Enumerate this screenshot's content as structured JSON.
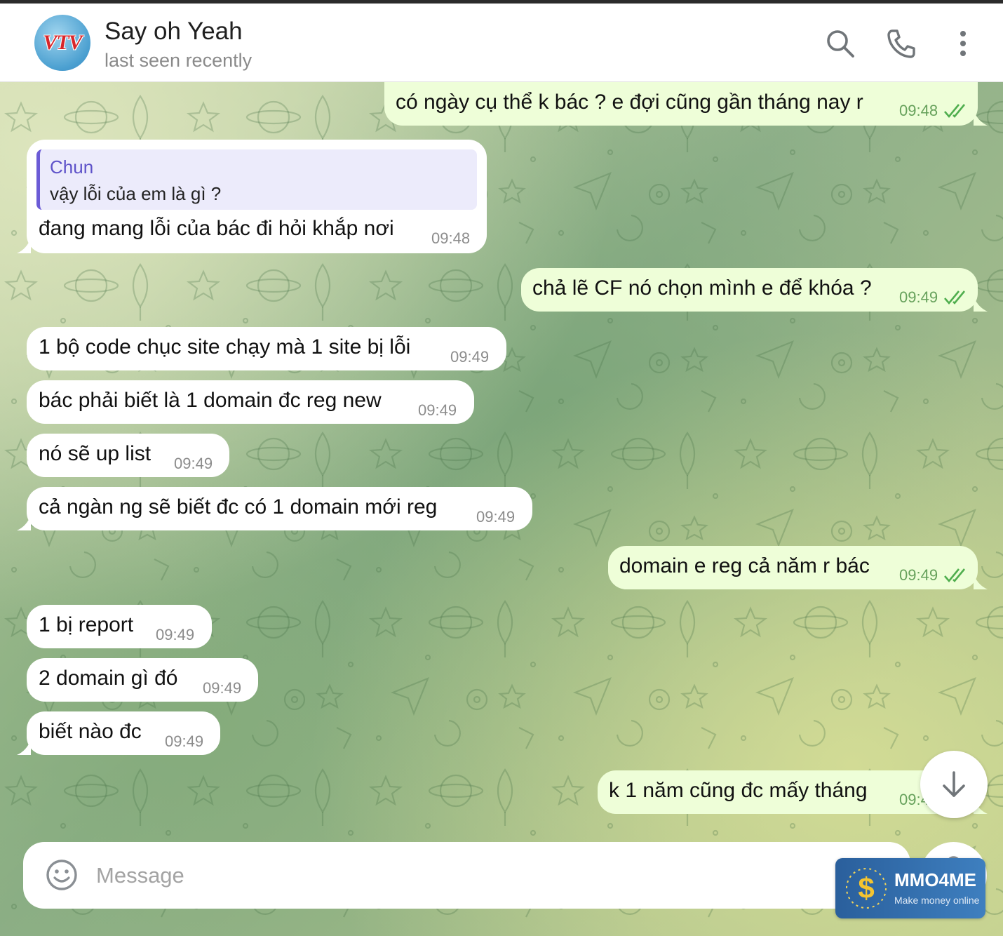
{
  "header": {
    "avatar_text": "VTV",
    "title": "Say oh Yeah",
    "status": "last seen recently",
    "icons": [
      "search-icon",
      "phone-icon",
      "more-vertical-icon"
    ]
  },
  "messages": [
    {
      "dir": "out",
      "text": "có ngày cụ thể k bác ? e đợi cũng gần tháng nay r",
      "time": "09:48",
      "read": true
    },
    {
      "dir": "in",
      "reply_name": "Chun",
      "reply_text": "vậy lỗi của em là gì ?",
      "text": "đang mang lỗi của bác đi hỏi khắp nơi",
      "time": "09:48"
    },
    {
      "dir": "out",
      "text": "chả lẽ CF nó chọn mình e để khóa ?",
      "time": "09:49",
      "read": true
    },
    {
      "dir": "in",
      "text": "1 bộ code chục site chạy mà 1 site bị lỗi",
      "time": "09:49"
    },
    {
      "dir": "in",
      "text": "bác phải biết là 1 domain đc reg new",
      "time": "09:49"
    },
    {
      "dir": "in",
      "text": "nó sẽ up list",
      "time": "09:49"
    },
    {
      "dir": "in",
      "text": "cả ngàn ng sẽ biết đc có 1 domain mới reg",
      "time": "09:49"
    },
    {
      "dir": "out",
      "text": "domain e reg cả năm r bác",
      "time": "09:49",
      "read": true
    },
    {
      "dir": "in",
      "text": "1 bị report",
      "time": "09:49"
    },
    {
      "dir": "in",
      "text": "2 domain gì đó",
      "time": "09:49"
    },
    {
      "dir": "in",
      "text": "biết nào đc",
      "time": "09:49"
    },
    {
      "dir": "out",
      "text": "k 1 năm cũng đc mấy tháng",
      "time": "09:4"
    }
  ],
  "composer": {
    "placeholder": "Message",
    "icons": [
      "emoji-icon",
      "attach-icon",
      "microphone-icon"
    ]
  },
  "scroll_down_icon": "arrow-down-icon",
  "watermark": {
    "title": "MMO4ME",
    "subtitle": "Make money online"
  },
  "colors": {
    "incoming_bubble": "#ffffff",
    "outgoing_bubble": "#eefed8",
    "read_check": "#4fae4e",
    "reply_accent": "#6b5bd6"
  }
}
